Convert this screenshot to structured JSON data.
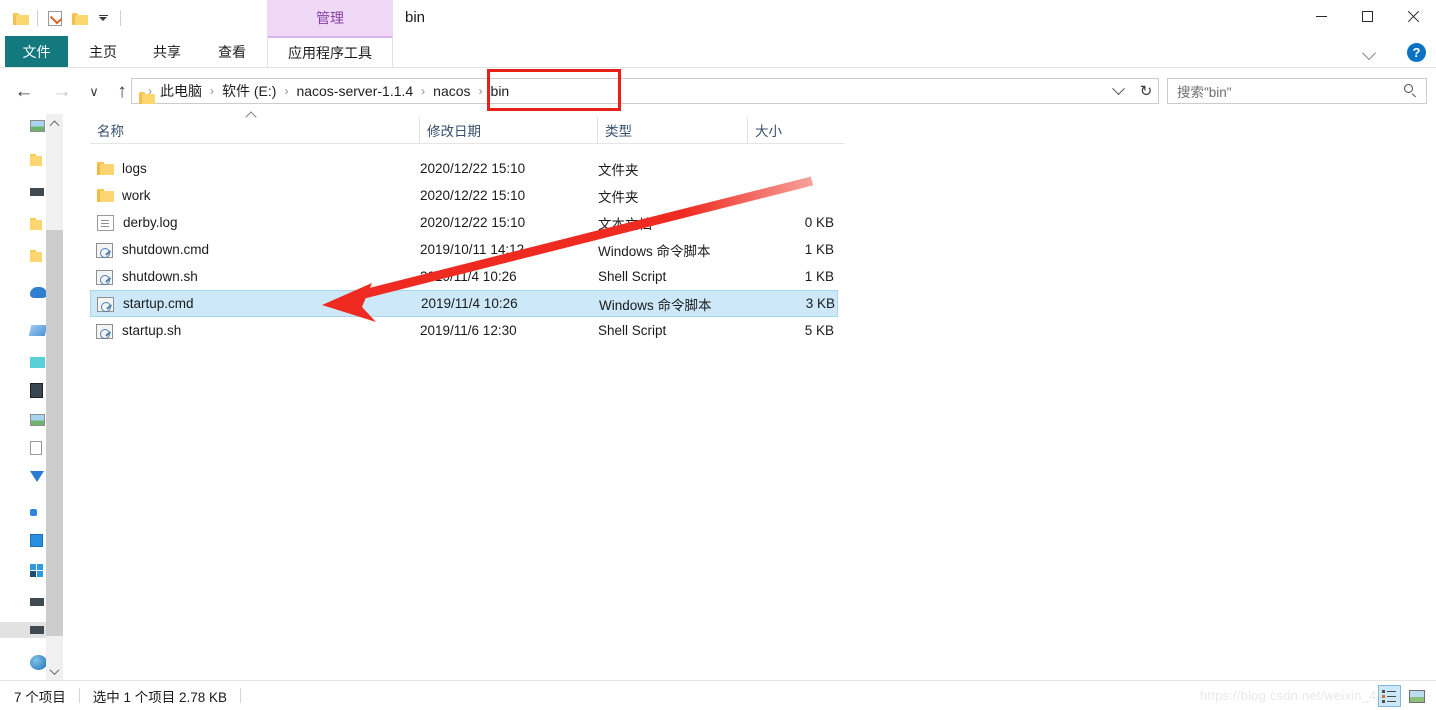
{
  "window": {
    "title": "bin",
    "quick_access": [
      {
        "name": "folder-icon",
        "label": "文件夹"
      },
      {
        "name": "properties-icon",
        "label": "属性"
      },
      {
        "name": "new-folder-icon",
        "label": "新建文件夹"
      },
      {
        "name": "customize-dropdown-icon",
        "label": "自定义快速访问工具栏"
      }
    ],
    "contextual_tab_header": "管理",
    "controls": {
      "minimize": "最小化",
      "maximize": "最大化",
      "close": "关闭"
    },
    "help_label": "?"
  },
  "ribbon": {
    "tabs": [
      {
        "label": "文件",
        "active": false,
        "style": "file"
      },
      {
        "label": "主页",
        "active": false,
        "style": "normal"
      },
      {
        "label": "共享",
        "active": false,
        "style": "normal"
      },
      {
        "label": "查看",
        "active": false,
        "style": "normal"
      },
      {
        "label": "应用程序工具",
        "active": true,
        "style": "contextual"
      }
    ],
    "collapse_label": "折叠功能区"
  },
  "navigation": {
    "back": "←",
    "forward": "→",
    "recent": "∨",
    "up": "↑",
    "refresh": "↻",
    "breadcrumb": [
      {
        "label": "此电脑",
        "highlighted": false
      },
      {
        "label": "软件 (E:)",
        "highlighted": false
      },
      {
        "label": "nacos-server-1.1.4",
        "highlighted": false
      },
      {
        "label": "nacos",
        "highlighted": true
      },
      {
        "label": "bin",
        "highlighted": true
      }
    ],
    "separator": "›"
  },
  "search": {
    "placeholder": "搜索\"bin\"",
    "value": ""
  },
  "columns": [
    {
      "key": "name",
      "label": "名称",
      "sort": "asc"
    },
    {
      "key": "date",
      "label": "修改日期",
      "sort": null
    },
    {
      "key": "type",
      "label": "类型",
      "sort": null
    },
    {
      "key": "size",
      "label": "大小",
      "sort": null
    }
  ],
  "files": [
    {
      "name": "logs",
      "date": "2020/12/22 15:10",
      "type": "文件夹",
      "size": "",
      "icon": "folder-icon",
      "selected": false
    },
    {
      "name": "work",
      "date": "2020/12/22 15:10",
      "type": "文件夹",
      "size": "",
      "icon": "folder-icon",
      "selected": false
    },
    {
      "name": "derby.log",
      "date": "2020/12/22 15:10",
      "type": "文本文档",
      "size": "0 KB",
      "icon": "text-file-icon",
      "selected": false
    },
    {
      "name": "shutdown.cmd",
      "date": "2019/10/11 14:12",
      "type": "Windows 命令脚本",
      "size": "1 KB",
      "icon": "script-icon",
      "selected": false
    },
    {
      "name": "shutdown.sh",
      "date": "2019/11/4 10:26",
      "type": "Shell Script",
      "size": "1 KB",
      "icon": "script-icon",
      "selected": false
    },
    {
      "name": "startup.cmd",
      "date": "2019/11/4 10:26",
      "type": "Windows 命令脚本",
      "size": "3 KB",
      "icon": "script-icon",
      "selected": true
    },
    {
      "name": "startup.sh",
      "date": "2019/11/6 12:30",
      "type": "Shell Script",
      "size": "5 KB",
      "icon": "script-icon",
      "selected": false
    }
  ],
  "status": {
    "item_count": "7 个项目",
    "selection": "选中 1 个项目  2.78 KB"
  },
  "view_buttons": [
    {
      "name": "details-view-button",
      "label": "详细信息",
      "active": true
    },
    {
      "name": "large-icons-view-button",
      "label": "大图标",
      "active": false
    }
  ],
  "watermark": "https://blog.csdn.net/weixin_44",
  "annotations": {
    "breadcrumb_box_color": "#e8201a",
    "arrow_color": "#ee2b20",
    "arrow_target": "startup.cmd"
  },
  "colors": {
    "file_tab": "#14797f",
    "contextual": "#efd9f7",
    "selection": "#cce8f9",
    "header_text": "#37506d"
  }
}
